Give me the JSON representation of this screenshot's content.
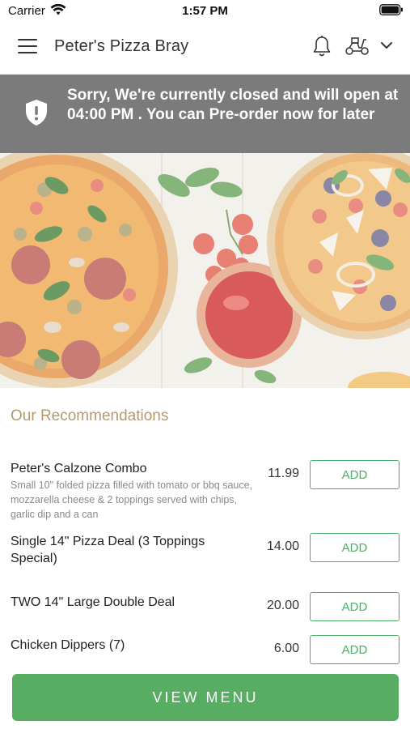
{
  "status_bar": {
    "carrier": "Carrier",
    "time": "1:57 PM"
  },
  "header": {
    "title": "Peter's Pizza Bray",
    "icons": [
      "menu-icon",
      "bell-icon",
      "scooter-icon",
      "chevron-down-icon"
    ]
  },
  "banner": {
    "message": "Sorry, We're currently closed and will open at 04:00 PM . You can Pre-order now for later",
    "icon": "shield-alert-icon",
    "background": "#7b7b7b"
  },
  "recommendations": {
    "heading": "Our Recommendations",
    "items": [
      {
        "name": "Peter's Calzone Combo",
        "description": "Small 10\" folded pizza filled with tomato or bbq sauce, mozzarella cheese & 2 toppings served with chips, garlic dip and a can",
        "price": "11.99",
        "button": "ADD"
      },
      {
        "name": "Single 14\" Pizza Deal (3 Toppings Special)",
        "description": "",
        "price": "14.00",
        "button": "ADD"
      },
      {
        "name": "TWO 14\" Large Double Deal",
        "description": "",
        "price": "20.00",
        "button": "ADD"
      },
      {
        "name": "Chicken Dippers (7)",
        "description": "",
        "price": "6.00",
        "button": "ADD"
      }
    ]
  },
  "footer": {
    "view_menu_label": "VIEW MENU"
  },
  "colors": {
    "accent": "#57ad62",
    "heading": "#b49a6e",
    "banner": "#7b7b7b"
  }
}
